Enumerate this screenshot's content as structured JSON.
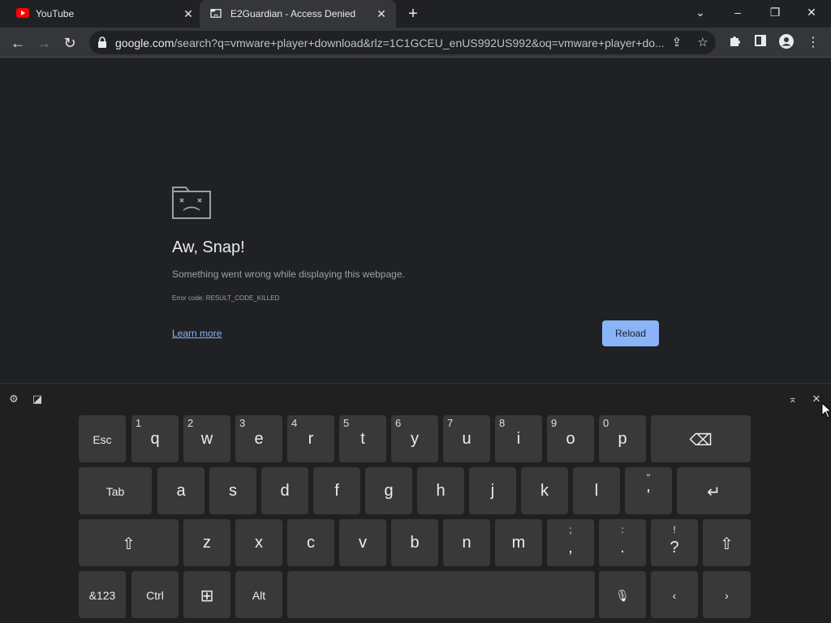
{
  "tabs": [
    {
      "title": "YouTube",
      "favicon": "youtube-icon"
    },
    {
      "title": "E2Guardian - Access Denied",
      "favicon": "sad-page-icon"
    }
  ],
  "omnibox": {
    "host": "google.com",
    "path": "/search?q=vmware+player+download&rlz=1C1GCEU_enUS992US992&oq=vmware+player+do..."
  },
  "error_page": {
    "title": "Aw, Snap!",
    "description": "Something went wrong while displaying this webpage.",
    "error_code": "Error code: RESULT_CODE_KILLED",
    "learn_more": "Learn more",
    "reload": "Reload"
  },
  "keyboard": {
    "row1": [
      {
        "label": "Esc"
      },
      {
        "label": "q",
        "sec": "1"
      },
      {
        "label": "w",
        "sec": "2"
      },
      {
        "label": "e",
        "sec": "3"
      },
      {
        "label": "r",
        "sec": "4"
      },
      {
        "label": "t",
        "sec": "5"
      },
      {
        "label": "y",
        "sec": "6"
      },
      {
        "label": "u",
        "sec": "7"
      },
      {
        "label": "i",
        "sec": "8"
      },
      {
        "label": "o",
        "sec": "9"
      },
      {
        "label": "p",
        "sec": "0"
      }
    ],
    "row2": [
      {
        "label": "Tab"
      },
      {
        "label": "a"
      },
      {
        "label": "s"
      },
      {
        "label": "d"
      },
      {
        "label": "f"
      },
      {
        "label": "g"
      },
      {
        "label": "h"
      },
      {
        "label": "j"
      },
      {
        "label": "k"
      },
      {
        "label": "l"
      },
      {
        "label": "'",
        "top": "\""
      }
    ],
    "row3": [
      {
        "label": "z"
      },
      {
        "label": "x"
      },
      {
        "label": "c"
      },
      {
        "label": "v"
      },
      {
        "label": "b"
      },
      {
        "label": "n"
      },
      {
        "label": "m"
      },
      {
        "label": ",",
        "top": ";"
      },
      {
        "label": ".",
        "top": ":"
      },
      {
        "label": "?",
        "top": "!"
      }
    ],
    "row4": {
      "sym": "&123",
      "ctrl": "Ctrl",
      "alt": "Alt"
    }
  }
}
